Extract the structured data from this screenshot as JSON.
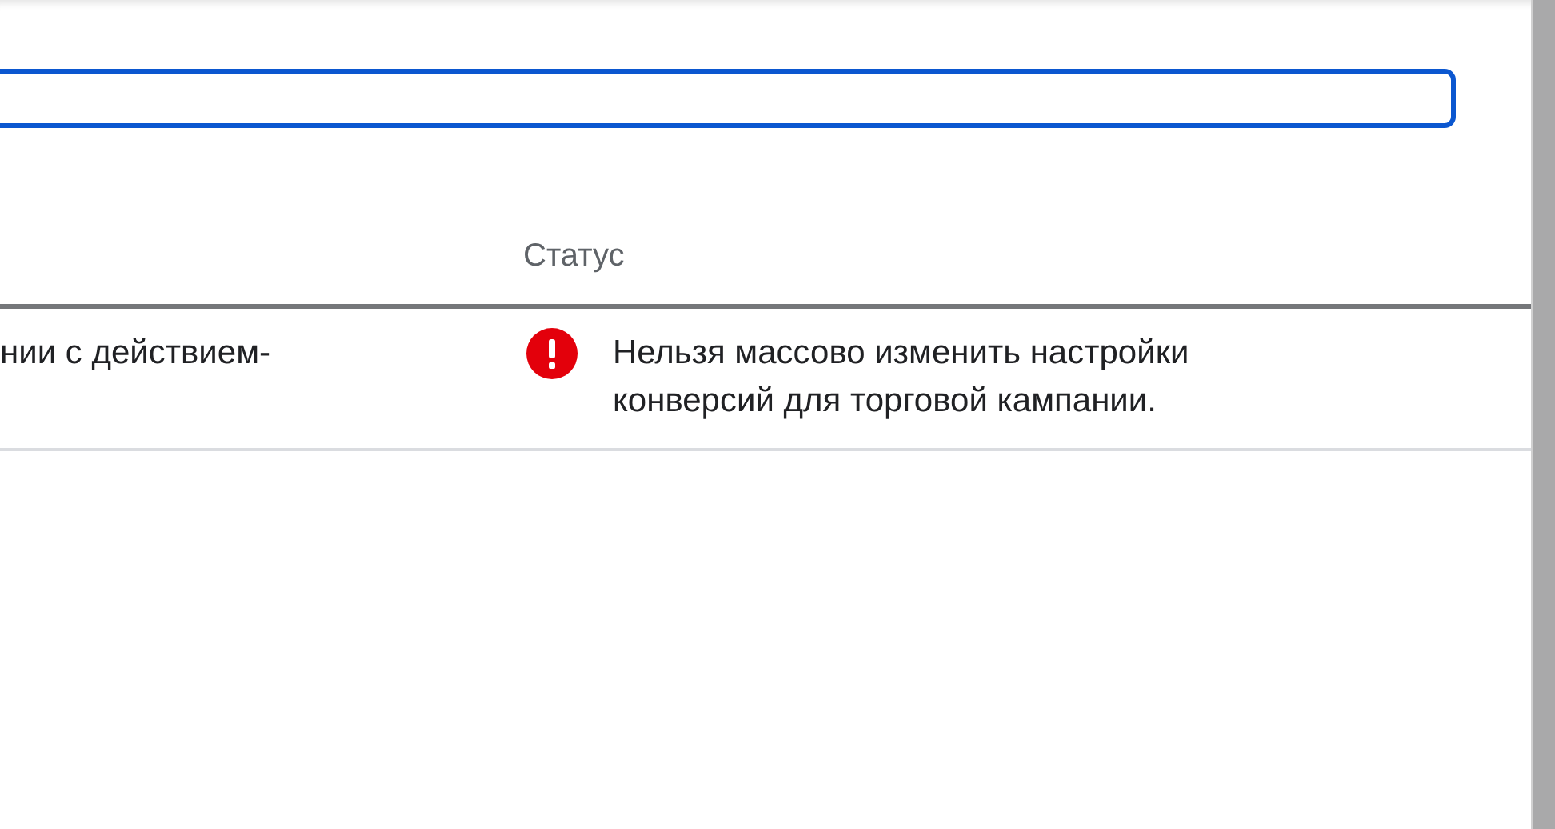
{
  "input_field": {
    "focused": true
  },
  "table": {
    "status_header": "Статус",
    "rows": [
      {
        "column_1": "нии с действием-",
        "status": {
          "kind": "error",
          "message": "Нельзя массово изменить настройки конверсий для торговой кампании."
        }
      }
    ]
  }
}
